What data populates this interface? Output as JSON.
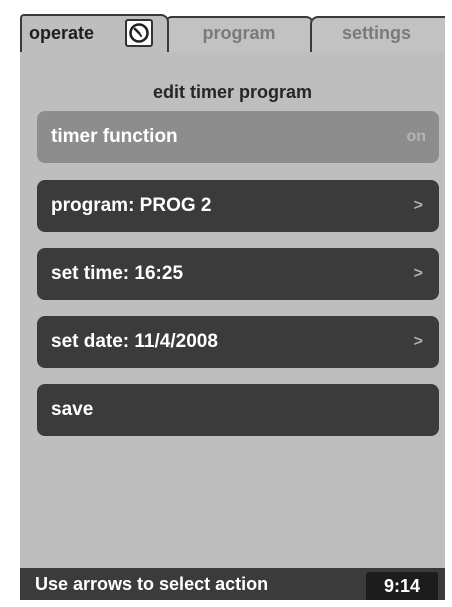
{
  "tabs": {
    "operate": "operate",
    "program": "program",
    "settings": "settings"
  },
  "icons": {
    "operate_tab": "clock-icon"
  },
  "colors": {
    "panel_bg": "#bebebe",
    "row_bg": "#3b3b3b",
    "row_disabled_bg": "#8d8d8d",
    "text_light": "#ffffff"
  },
  "heading": "edit timer program",
  "menu": {
    "timer_function": {
      "label": "timer function",
      "value": "on"
    },
    "program": {
      "label": "program: PROG 2",
      "arrow": ">"
    },
    "set_time": {
      "label": "set time: 16:25",
      "arrow": ">"
    },
    "set_date": {
      "label": "set date: 11/4/2008",
      "arrow": ">"
    },
    "save": {
      "label": "save"
    }
  },
  "status": {
    "message": "Use arrows to select action",
    "time": "9:14"
  }
}
